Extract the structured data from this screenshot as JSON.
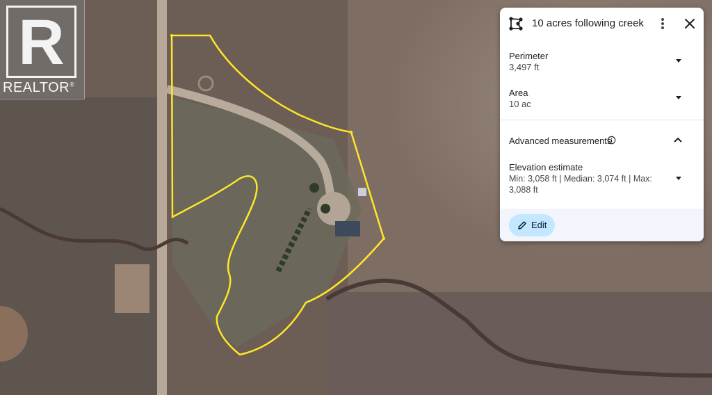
{
  "watermark": {
    "letter": "R",
    "brand": "REALTOR",
    "mark": "®"
  },
  "panel": {
    "title": "10 acres following creek",
    "icons": {
      "polygon": "polygon-area-icon",
      "more": "more-vert-icon",
      "close": "close-icon"
    },
    "perimeter": {
      "label": "Perimeter",
      "value": "3,497 ft"
    },
    "area": {
      "label": "Area",
      "value": "10 ac"
    },
    "advanced": {
      "label": "Advanced measurements"
    },
    "elevation": {
      "label": "Elevation estimate",
      "value": "Min: 3,058 ft | Median: 3,074 ft | Max: 3,088 ft"
    },
    "edit_label": "Edit"
  },
  "colors": {
    "boundary": "#ffe629",
    "edit_button": "#c2e7ff",
    "footer": "#f2f6fc"
  }
}
